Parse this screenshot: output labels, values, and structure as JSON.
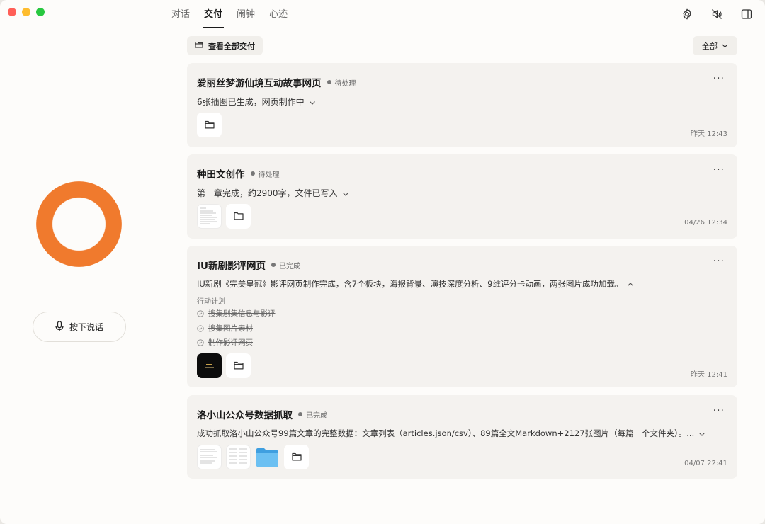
{
  "window": {
    "title": ""
  },
  "left": {
    "talk_button": "按下说话"
  },
  "tabs": [
    {
      "label": "对话",
      "active": false
    },
    {
      "label": "交付",
      "active": true
    },
    {
      "label": "闹钟",
      "active": false
    },
    {
      "label": "心迹",
      "active": false
    }
  ],
  "toolbar": {
    "view_all": "查看全部交付",
    "filter": "全部"
  },
  "icons": [
    "settings-icon",
    "mute-icon",
    "sidebar-toggle-icon",
    "folder-icon",
    "mic-icon",
    "chevron-down-icon",
    "more-icon"
  ],
  "colors": {
    "accent": "#f07a2d",
    "card_bg": "#f4f2ef",
    "window_bg": "#fdfcfa"
  },
  "cards": [
    {
      "title": "爱丽丝梦游仙境互动故事网页",
      "status": "待处理",
      "summary": "6张插图已生成，网页制作中",
      "timestamp": "昨天 12:43",
      "more": "···"
    },
    {
      "title": "种田文创作",
      "status": "待处理",
      "summary": "第一章完成，约2900字，文件已写入",
      "timestamp": "04/26 12:34",
      "more": "···"
    },
    {
      "title": "IU新剧影评网页",
      "status": "已完成",
      "summary": "IU新剧《完美皇冠》影评网页制作完成，含7个板块，海报背景、演技深度分析、9维评分卡动画，两张图片成功加载。",
      "plan_label": "行动计划",
      "plan": [
        "搜集剧集信息与影评",
        "搜集图片素材",
        "制作影评网页"
      ],
      "timestamp": "昨天 12:41",
      "more": "···"
    },
    {
      "title": "洛小山公众号数据抓取",
      "status": "已完成",
      "summary": "成功抓取洛小山公众号99篇文章的完整数据：文章列表（articles.json/csv）、89篇全文Markdown+2127张图片（每篇一个文件夹）。...",
      "timestamp": "04/07 22:41",
      "more": "···"
    }
  ]
}
